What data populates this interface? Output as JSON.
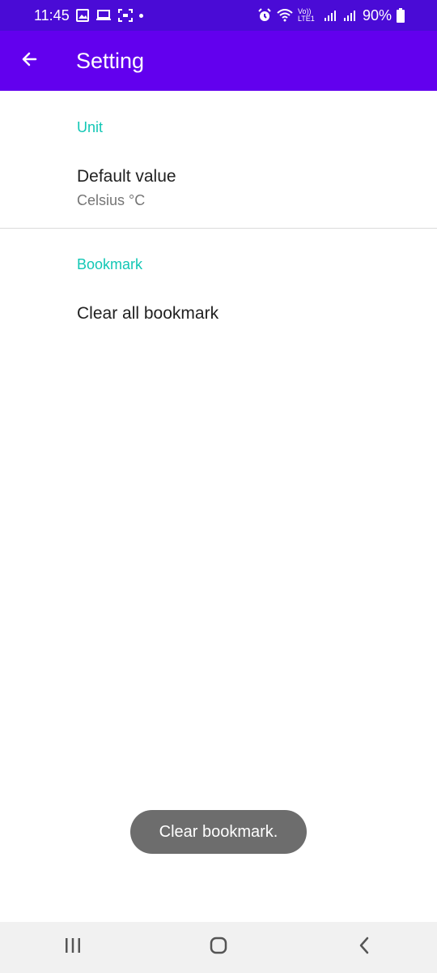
{
  "status_bar": {
    "time": "11:45",
    "battery": "90%",
    "network_label": "Vo)) LTE1"
  },
  "app_bar": {
    "title": "Setting",
    "back_icon": "arrow-left-icon"
  },
  "sections": {
    "unit": {
      "header": "Unit",
      "default_value_title": "Default value",
      "default_value_summary": "Celsius °C"
    },
    "bookmark": {
      "header": "Bookmark",
      "clear_title": "Clear all bookmark"
    }
  },
  "toast": "Clear bookmark.",
  "nav_bar": {
    "recents_icon": "recents-icon",
    "home_icon": "home-icon",
    "back_icon": "back-chevron-icon"
  },
  "colors": {
    "status_bar": "#4a0bd6",
    "app_bar": "#6200ee",
    "accent": "#13c7b5"
  }
}
